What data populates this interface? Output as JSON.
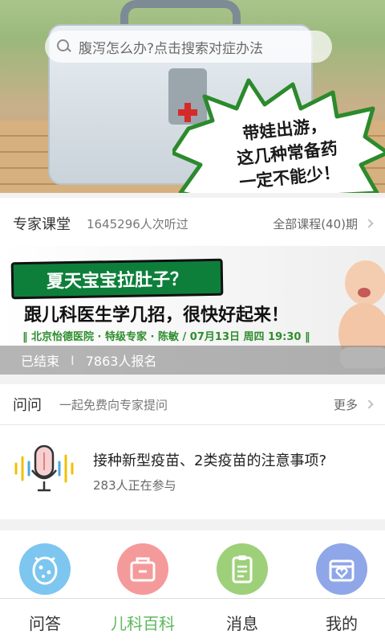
{
  "search": {
    "placeholder": "腹泻怎么办?点击搜索对症办法"
  },
  "hero": {
    "promo_lines": [
      "带娃出游，",
      "这几种常备药",
      "一定不能少！"
    ]
  },
  "expert": {
    "title": "专家课堂",
    "listen_count": "1645296人次听过",
    "all_courses": "全部课程(40)期"
  },
  "banner": {
    "tag": "夏天宝宝拉肚子？",
    "headline": "跟儿科医生学几招，很快好起来！",
    "info": "‖ 北京怡德医院 · 特级专家 · 陈敏 / 07月13日 周四 19:30 ‖",
    "status": "已结束",
    "separator": "I",
    "signups": "7863人报名"
  },
  "ask": {
    "title": "问问",
    "subtitle": "一起免费向专家提问",
    "more": "更多"
  },
  "qa": {
    "question": "接种新型疫苗、2类疫苗的注意事项?",
    "participants": "283人正在参与"
  },
  "nav": {
    "active_color": "#5cb85c",
    "tabs": [
      {
        "label": "问答",
        "icon": "germ-icon",
        "color": "#7cc6ef"
      },
      {
        "label": "儿科百科",
        "icon": "medical-kit-icon",
        "color": "#f59a9a"
      },
      {
        "label": "消息",
        "icon": "clipboard-icon",
        "color": "#9ed07a"
      },
      {
        "label": "我的",
        "icon": "baby-bed-icon",
        "color": "#8fa6e8"
      }
    ]
  }
}
